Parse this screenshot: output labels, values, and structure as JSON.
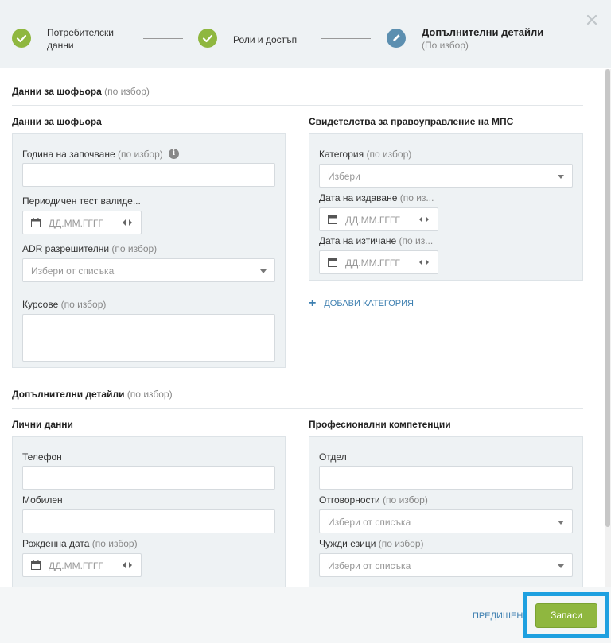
{
  "wizard": {
    "steps": [
      {
        "label_line1": "Потребителски",
        "label_line2": "данни",
        "state": "done"
      },
      {
        "label": "Роли и достъп",
        "state": "done"
      },
      {
        "label": "Допълнителни детайли",
        "sublabel": "(По избор)",
        "state": "current"
      }
    ],
    "colors": {
      "done": "#8fb73f",
      "current": "#5c8fb0"
    }
  },
  "driver_section": {
    "title": "Данни за шофьора",
    "optional": "(по избор)",
    "left": {
      "title": "Данни за шофьора",
      "start_year_label": "Година на започване",
      "start_year_optional": "(по избор)",
      "start_year_value": "",
      "periodic_test_label": "Периодичен тест валиде...",
      "periodic_test_placeholder": "ДД.ММ.ГГГГ",
      "adr_label": "ADR разрешителни",
      "adr_optional": "(по избор)",
      "adr_placeholder": "Избери от списъка",
      "courses_label": "Курсове",
      "courses_optional": "(по избор)",
      "courses_value": ""
    },
    "right": {
      "title": "Свидетелства за правоуправление на МПС",
      "category_label": "Категория",
      "category_optional": "(по избор)",
      "category_placeholder": "Избери",
      "issue_date_label": "Дата на издаване",
      "issue_date_optional": "(по из...",
      "issue_date_placeholder": "ДД.ММ.ГГГГ",
      "expiry_date_label": "Дата на изтичане",
      "expiry_date_optional": "(по из...",
      "expiry_date_placeholder": "ДД.ММ.ГГГГ",
      "add_category": "ДОБАВИ КАТЕГОРИЯ"
    }
  },
  "extra_section": {
    "title": "Допълнителни детайли",
    "optional": "(по избор)",
    "left": {
      "title": "Лични данни",
      "phone_label": "Телефон",
      "phone_value": "",
      "mobile_label": "Мобилен",
      "mobile_value": "",
      "birth_label": "Рожденна дата",
      "birth_optional": "(по избор)",
      "birth_placeholder": "ДД.ММ.ГГГГ"
    },
    "right": {
      "title": "Професионални компетенции",
      "dept_label": "Отдел",
      "dept_value": "",
      "resp_label": "Отговорности",
      "resp_optional": "(по избор)",
      "resp_placeholder": "Избери от списъка",
      "lang_label": "Чужди езици",
      "lang_optional": "(по избор)",
      "lang_placeholder": "Избери от списъка"
    }
  },
  "footer": {
    "prev_label": "ПРЕДИШЕН",
    "save_label": "Запаси"
  }
}
